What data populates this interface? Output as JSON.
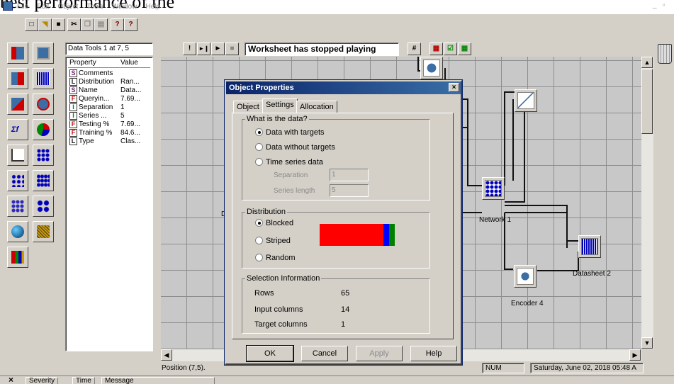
{
  "clip_text": "best performance of the",
  "menu": [
    "File",
    "Edit",
    "Object",
    "Tools",
    "Window",
    "Help"
  ],
  "toolbar": {
    "buttons": [
      "new-icon",
      "open-icon",
      "save-icon",
      "cut-icon",
      "copy-icon",
      "paste-icon",
      "help-icon",
      "context-help-icon"
    ],
    "play_controls": [
      "!",
      "►❙",
      "►",
      "■"
    ],
    "worksheet_status": "Worksheet has stopped playing",
    "grid_glyph": "#"
  },
  "properties_panel": {
    "title": "Data Tools 1 at 7, 5",
    "col_property": "Property",
    "col_value": "Value",
    "rows": [
      {
        "badge": "S",
        "name": "Comments",
        "value": ""
      },
      {
        "badge": "L",
        "name": "Distribution",
        "value": "Ran..."
      },
      {
        "badge": "S",
        "name": "Name",
        "value": "Data..."
      },
      {
        "badge": "F",
        "name": "Queryin...",
        "value": "7.69..."
      },
      {
        "badge": "I",
        "name": "Separation",
        "value": "1"
      },
      {
        "badge": "I",
        "name": "Series ...",
        "value": "5"
      },
      {
        "badge": "F",
        "name": "Testing %",
        "value": "7.69..."
      },
      {
        "badge": "F",
        "name": "Training %",
        "value": "84.6..."
      },
      {
        "badge": "L",
        "name": "Type",
        "value": "Clas..."
      }
    ]
  },
  "canvas": {
    "nodes": [
      {
        "label": "Network 1"
      },
      {
        "label": "Datasheet 2"
      },
      {
        "label": "Encoder 4"
      }
    ],
    "partial_label": "D"
  },
  "dialog": {
    "title": "Object Properties",
    "tabs": [
      "Object",
      "Settings",
      "Allocation"
    ],
    "active_tab": "Settings",
    "data_group": {
      "title": "What is the data?",
      "options": [
        "Data with targets",
        "Data without targets",
        "Time series data"
      ],
      "selected": "Data with targets",
      "separation_label": "Separation",
      "separation_value": "1",
      "series_length_label": "Series length",
      "series_length_value": "5"
    },
    "distribution_group": {
      "title": "Distribution",
      "options": [
        "Blocked",
        "Striped",
        "Random"
      ],
      "selected": "Blocked",
      "bar_fractions": {
        "red": 0.846,
        "blue": 0.077,
        "green": 0.077
      },
      "colors": {
        "red": "#ff0000",
        "blue": "#0000ff",
        "green": "#008000"
      }
    },
    "selection_group": {
      "title": "Selection Information",
      "rows": [
        {
          "label": "Rows",
          "value": "65"
        },
        {
          "label": "Input columns",
          "value": "14"
        },
        {
          "label": "Target columns",
          "value": "1"
        }
      ]
    },
    "buttons": [
      "OK",
      "Cancel",
      "Apply",
      "Help"
    ]
  },
  "status_bar": {
    "position": "Position (7,5).",
    "num": "NUM",
    "datetime": "Saturday, June 02, 2018  05:48 A"
  },
  "message_bar": {
    "columns": [
      "Severity",
      "Time",
      "Message"
    ]
  },
  "colors": {
    "title_blue": "#0a246a",
    "face": "#d4d0c8",
    "canvas": "#c8c8c8"
  }
}
